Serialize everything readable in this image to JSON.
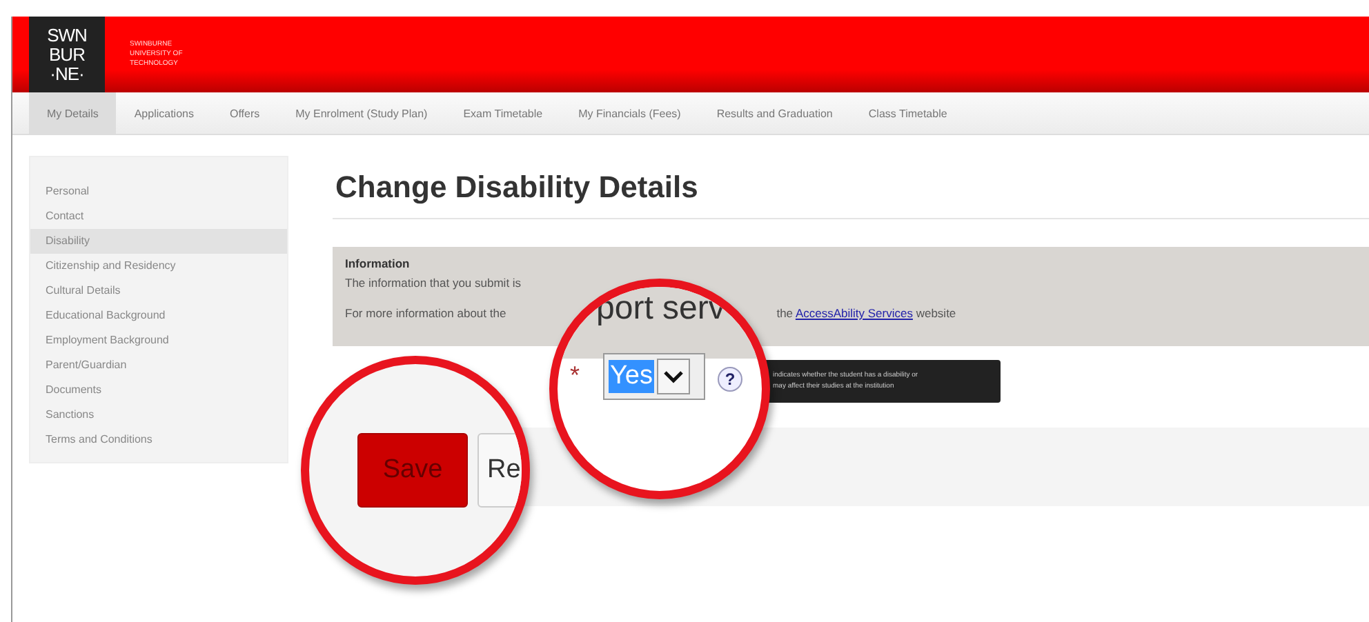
{
  "header": {
    "logo_lines": [
      "SWN",
      "BUR",
      "·NE·"
    ],
    "university_lines": [
      "SWINBURNE",
      "UNIVERSITY OF",
      "TECHNOLOGY"
    ]
  },
  "nav": [
    {
      "label": "My Details",
      "selected": true
    },
    {
      "label": "Applications",
      "selected": false
    },
    {
      "label": "Offers",
      "selected": false
    },
    {
      "label": "My Enrolment (Study Plan)",
      "selected": false
    },
    {
      "label": "Exam Timetable",
      "selected": false
    },
    {
      "label": "My Financials (Fees)",
      "selected": false
    },
    {
      "label": "Results and Graduation",
      "selected": false
    },
    {
      "label": "Class Timetable",
      "selected": false
    }
  ],
  "sidebar": [
    {
      "label": "Personal",
      "selected": false
    },
    {
      "label": "Contact",
      "selected": false
    },
    {
      "label": "Disability",
      "selected": true
    },
    {
      "label": "Citizenship and Residency",
      "selected": false
    },
    {
      "label": "Cultural Details",
      "selected": false
    },
    {
      "label": "Educational Background",
      "selected": false
    },
    {
      "label": "Employment Background",
      "selected": false
    },
    {
      "label": "Parent/Guardian",
      "selected": false
    },
    {
      "label": "Documents",
      "selected": false
    },
    {
      "label": "Sanctions",
      "selected": false
    },
    {
      "label": "Terms and Conditions",
      "selected": false
    }
  ],
  "page_title": "Change Disability Details",
  "info": {
    "heading": "Information",
    "line_1": "The information that you submit is",
    "line_2_start": "For more information about the",
    "line_2_middle": "the",
    "line_2_link": "AccessAbility Services",
    "line_2_end": "website"
  },
  "magnifier_1": {
    "heading_fragment": "port serv",
    "required_mark": "*",
    "select_value": "Yes",
    "help": "?"
  },
  "tooltip": {
    "lines": [
      "indicates whether the student has a disability or",
      "may affect their studies at the institution"
    ]
  },
  "magnifier_2": {
    "buttons": [
      {
        "label": "Save",
        "kind": "primary"
      },
      {
        "label": "Re",
        "kind": "secondary"
      }
    ]
  }
}
